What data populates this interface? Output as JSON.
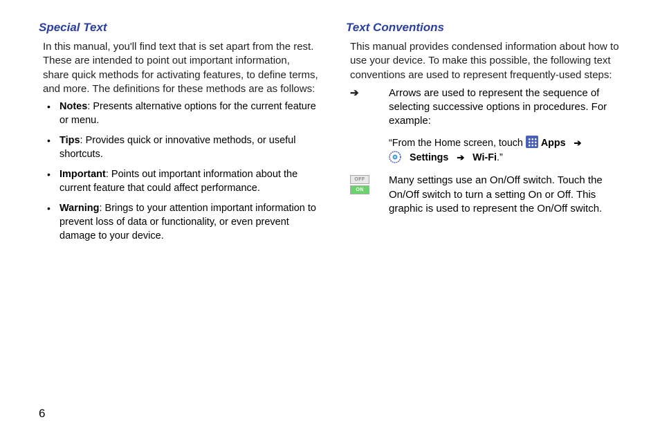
{
  "left": {
    "heading": "Special Text",
    "intro": "In this manual, you'll find text that is set apart from the rest. These are intended to point out important information, share quick methods for activating features, to define terms, and more. The definitions for these methods are as follows:",
    "items": [
      {
        "term": "Notes",
        "desc": ": Presents alternative options for the current feature or menu."
      },
      {
        "term": "Tips",
        "desc": ": Provides quick or innovative methods, or useful shortcuts."
      },
      {
        "term": "Important",
        "desc": ": Points out important information about the current feature that could affect performance."
      },
      {
        "term": "Warning",
        "desc": ": Brings to your attention important information to prevent loss of data or functionality, or even prevent damage to your device."
      }
    ]
  },
  "right": {
    "heading": "Text Conventions",
    "intro": "This manual provides condensed information about how to use your device. To make this possible, the following text conventions are used to represent frequently-used steps:",
    "arrow_symbol": "➔",
    "arrow_desc": "Arrows are used to represent the sequence of selecting successive options in procedures. For example:",
    "example_pre": "“From the Home screen, touch ",
    "example_apps": "Apps",
    "example_arrow1": "➔",
    "example_settings": "Settings",
    "example_arrow2": "➔",
    "example_wifi": "Wi-Fi",
    "example_end": ".”",
    "switch_off": "OFF",
    "switch_on": "ON",
    "switch_desc": "Many settings use an On/Off switch. Touch the On/Off switch to turn a setting On or Off. This graphic is used to represent the On/Off switch."
  },
  "page_number": "6"
}
